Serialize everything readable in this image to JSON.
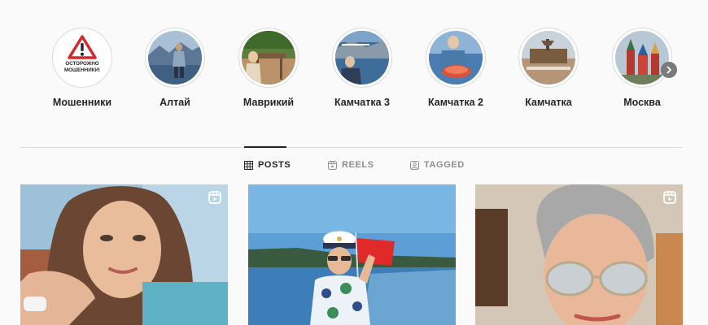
{
  "highlights": [
    {
      "label": "Мошенники",
      "icon": "warning-sign",
      "sign_text": "ОСТОРОЖНО МОШЕННИКИ!"
    },
    {
      "label": "Алтай",
      "icon": "photo-thumbnail"
    },
    {
      "label": "Маврикий",
      "icon": "photo-thumbnail"
    },
    {
      "label": "Камчатка 3",
      "icon": "photo-thumbnail"
    },
    {
      "label": "Камчатка 2",
      "icon": "photo-thumbnail"
    },
    {
      "label": "Камчатка",
      "icon": "photo-thumbnail"
    },
    {
      "label": "Москва",
      "icon": "photo-thumbnail"
    }
  ],
  "tabs": [
    {
      "label": "POSTS",
      "icon": "grid-icon",
      "active": true
    },
    {
      "label": "REELS",
      "icon": "reels-icon",
      "active": false
    },
    {
      "label": "TAGGED",
      "icon": "tagged-icon",
      "active": false
    }
  ],
  "posts": [
    {
      "type": "reel",
      "icon": "reel-badge-icon"
    },
    {
      "type": "photo"
    },
    {
      "type": "reel",
      "icon": "reel-badge-icon"
    }
  ],
  "colors": {
    "background": "#fafafa",
    "divider": "#dbdbdb",
    "active_text": "#262626",
    "inactive_text": "#8e8e8e",
    "warning_red": "#d62828"
  }
}
